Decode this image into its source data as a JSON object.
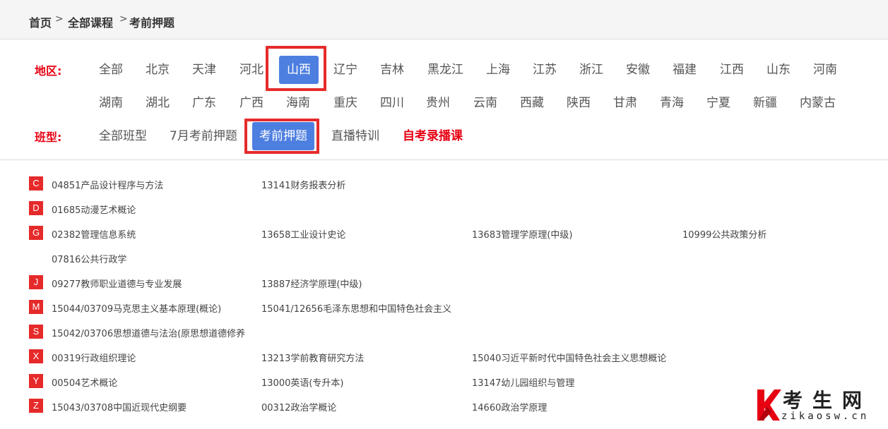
{
  "breadcrumb": {
    "home": "首页",
    "sep1": ">",
    "all_courses": "全部课程",
    "sep2": ">",
    "current": "考前押题"
  },
  "filters": {
    "region_label": "地区:",
    "class_label": "班型:",
    "regions": [
      "全部",
      "北京",
      "天津",
      "河北",
      "山西",
      "辽宁",
      "吉林",
      "黑龙江",
      "上海",
      "江苏",
      "浙江",
      "安徽",
      "福建",
      "江西",
      "山东",
      "河南",
      "湖南",
      "湖北",
      "广东",
      "广西",
      "海南",
      "重庆",
      "四川",
      "贵州",
      "云南",
      "西藏",
      "陕西",
      "甘肃",
      "青海",
      "宁夏",
      "新疆",
      "内蒙古"
    ],
    "selected_region": "山西",
    "class_types": [
      "全部班型",
      "7月考前押题",
      "考前押题",
      "直播特训",
      "自考录播课"
    ],
    "selected_class_type": "考前押题",
    "highlight_color": "#e60012",
    "active_color": "#4d7fe0"
  },
  "course_groups": [
    {
      "letter": "C",
      "courses": [
        "04851产品设计程序与方法",
        "13141财务报表分析"
      ]
    },
    {
      "letter": "D",
      "courses": [
        "01685动漫艺术概论"
      ]
    },
    {
      "letter": "G",
      "courses": [
        "02382管理信息系统",
        "13658工业设计史论",
        "13683管理学原理(中级)",
        "10999公共政策分析",
        "07816公共行政学"
      ]
    },
    {
      "letter": "J",
      "courses": [
        "09277教师职业道德与专业发展",
        "13887经济学原理(中级)"
      ]
    },
    {
      "letter": "M",
      "courses": [
        "15044/03709马克思主义基本原理(概论)",
        "15041/12656毛泽东思想和中国特色社会主义"
      ]
    },
    {
      "letter": "S",
      "courses": [
        "15042/03706思想道德与法治(原思想道德修养"
      ]
    },
    {
      "letter": "X",
      "courses": [
        "00319行政组织理论",
        "13213学前教育研究方法",
        "15040习近平新时代中国特色社会主义思想概论"
      ]
    },
    {
      "letter": "Y",
      "courses": [
        "00504艺术概论",
        "13000英语(专升本)",
        "13147幼儿园组织与管理"
      ]
    },
    {
      "letter": "Z",
      "courses": [
        "15043/03708中国近现代史纲要",
        "00312政治学概论",
        "14660政治学原理"
      ]
    }
  ],
  "watermark": {
    "cn": "考生网",
    "en": "zikaosw.cn",
    "brand_color": "#e60012"
  }
}
